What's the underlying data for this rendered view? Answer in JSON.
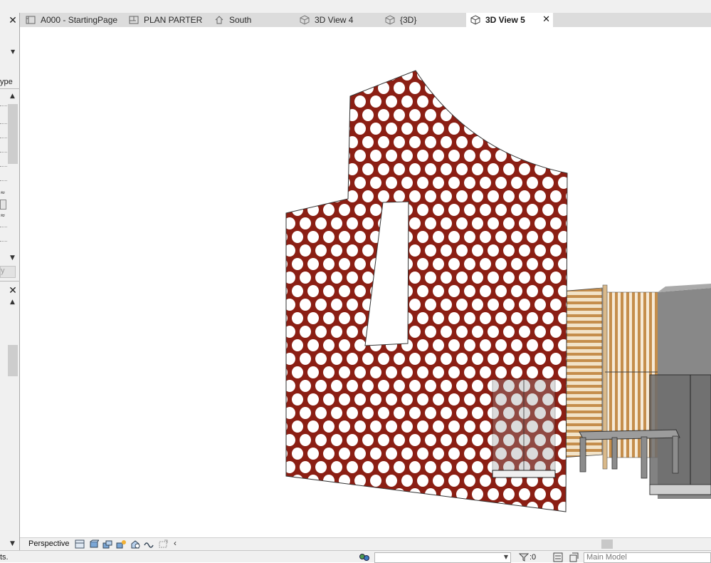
{
  "tabs": [
    {
      "label": "A000 - StartingPage",
      "icon": "sheet-icon"
    },
    {
      "label": "PLAN PARTER",
      "icon": "floor-plan-icon"
    },
    {
      "label": "South",
      "icon": "elevation-icon"
    },
    {
      "label": "3D View 4",
      "icon": "3d-cube-icon"
    },
    {
      "label": "{3D}",
      "icon": "3d-cube-icon"
    },
    {
      "label": "3D View 5",
      "icon": "3d-cube-icon",
      "active": true
    }
  ],
  "left_panel": {
    "type_label": "ype",
    "lower_label": "y"
  },
  "view_bar": {
    "view_mode": "Perspective",
    "icons": [
      "detail-level-icon",
      "visual-style-icon",
      "sun-path-icon",
      "shadows-icon",
      "render-icon",
      "crop-view-icon",
      "show-crop-icon"
    ]
  },
  "status_bar": {
    "left_text": "ts.",
    "workset_value": "",
    "count_value": ":0",
    "model_value": "Main Model"
  },
  "colors": {
    "panel_red": "#8b1f14",
    "wood": "#c58e4c",
    "tab_bar": "#dcdcdc"
  }
}
